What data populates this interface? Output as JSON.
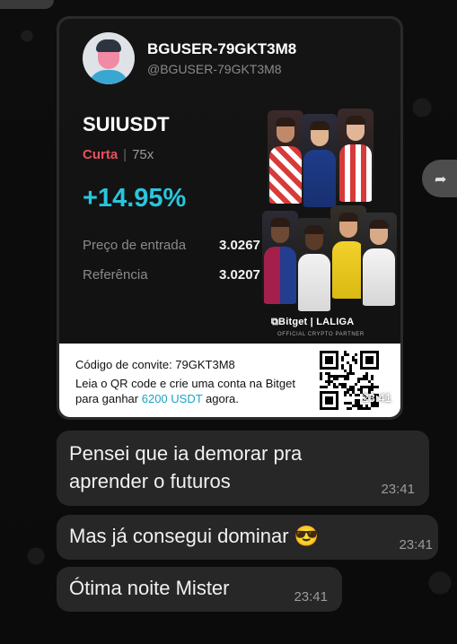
{
  "post": {
    "username": "BGUSER-79GKT3M8",
    "handle": "@BGUSER-79GKT3M8",
    "pair": "SUIUSDT",
    "side": "Curta",
    "leverage": "75x",
    "pnl": "+14.95%",
    "entry_label": "Preço de entrada",
    "entry_value": "3.0267",
    "ref_label": "Referência",
    "ref_value": "3.0207",
    "brand": "⧉Bitget | LALIGA",
    "brand_sub": "OFFICIAL CRYPTO PARTNER",
    "invite_code": "Código de convite: 79GKT3M8",
    "invite_text_pre": "Leia o QR code e crie uma conta na Bitget para ganhar ",
    "invite_amount": "6200 USDT",
    "invite_text_post": " agora.",
    "time": "23:41"
  },
  "messages": [
    {
      "text_line1": "Pensei que ia demorar pra",
      "text_line2": "aprender o futuros",
      "time": "23:41"
    },
    {
      "text": "Mas já consegui dominar 😎",
      "time": "23:41"
    },
    {
      "text": "Ótima noite Mister",
      "time": "23:41"
    }
  ],
  "colors": {
    "pnl": "#29c5dc",
    "short": "#e8505e",
    "bubble": "#272727",
    "highlight": "#1da2c6"
  },
  "icons": {
    "side_action": "forward-icon"
  }
}
